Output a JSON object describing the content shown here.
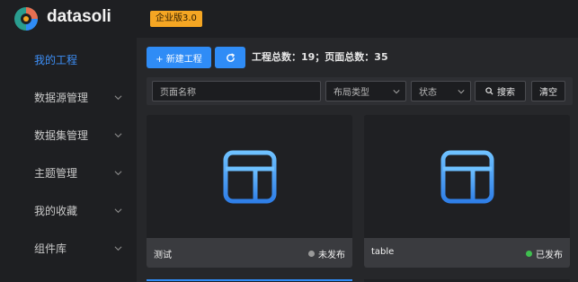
{
  "brand": {
    "name": "datasoli",
    "edition": "企业版3.0"
  },
  "sidebar": {
    "items": [
      {
        "label": "我的工程",
        "active": true
      },
      {
        "label": "数据源管理"
      },
      {
        "label": "数据集管理"
      },
      {
        "label": "主题管理"
      },
      {
        "label": "我的收藏"
      },
      {
        "label": "组件库"
      }
    ]
  },
  "toolbar": {
    "new_label": "+ 新建工程",
    "totals": "工程总数：19；页面总数：35"
  },
  "filters": {
    "name_placeholder": "页面名称",
    "layout_placeholder": "布局类型",
    "status_placeholder": "状态",
    "search_label": "搜索",
    "clear_label": "清空"
  },
  "cards": [
    {
      "name": "测试",
      "status": "未发布",
      "status_color": "#9a9a9a"
    },
    {
      "name": "table",
      "status": "已发布",
      "status_color": "#3fbf4f"
    }
  ],
  "colors": {
    "accent": "#2f8cf6",
    "edition_badge": "#f5a623",
    "icon_gradient_top": "#6ec1ff",
    "icon_gradient_bottom": "#2f7fe8"
  }
}
